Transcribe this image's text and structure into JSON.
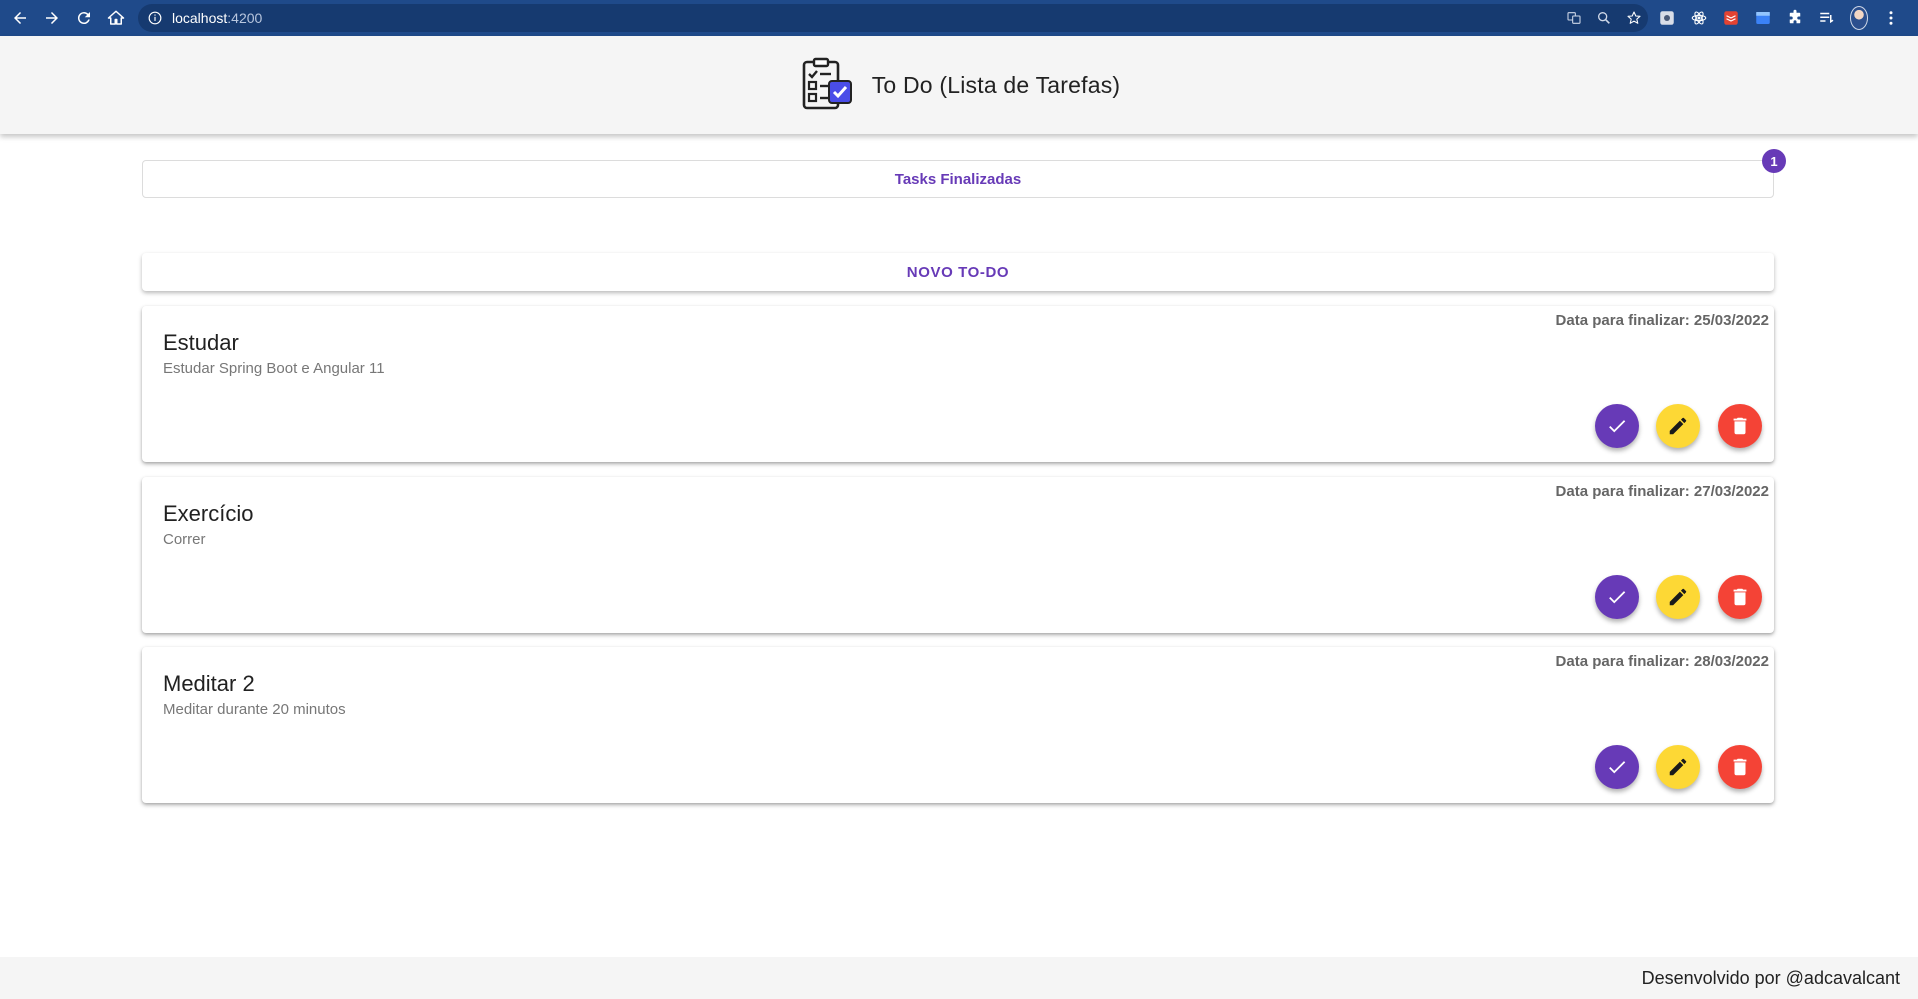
{
  "browser": {
    "url_host": "localhost",
    "url_port": ":4200"
  },
  "header": {
    "title": "To Do (Lista de Tarefas)"
  },
  "finished_button": {
    "label": "Tasks Finalizadas",
    "badge_count": "1"
  },
  "new_button": {
    "label": "NOVO TO-DO"
  },
  "tasks": [
    {
      "title": "Estudar",
      "description": "Estudar Spring Boot e Angular 11",
      "date_label": "Data para finalizar: 25/03/2022"
    },
    {
      "title": "Exercício",
      "description": "Correr",
      "date_label": "Data para finalizar: 27/03/2022"
    },
    {
      "title": "Meditar 2",
      "description": "Meditar durante 20 minutos",
      "date_label": "Data para finalizar: 28/03/2022"
    }
  ],
  "footer": {
    "text": "Desenvolvido por @adcavalcant"
  },
  "colors": {
    "primary": "#673ab7",
    "accent": "#fdd835",
    "warn": "#f44336",
    "browser_bar": "#1f4a8a"
  }
}
